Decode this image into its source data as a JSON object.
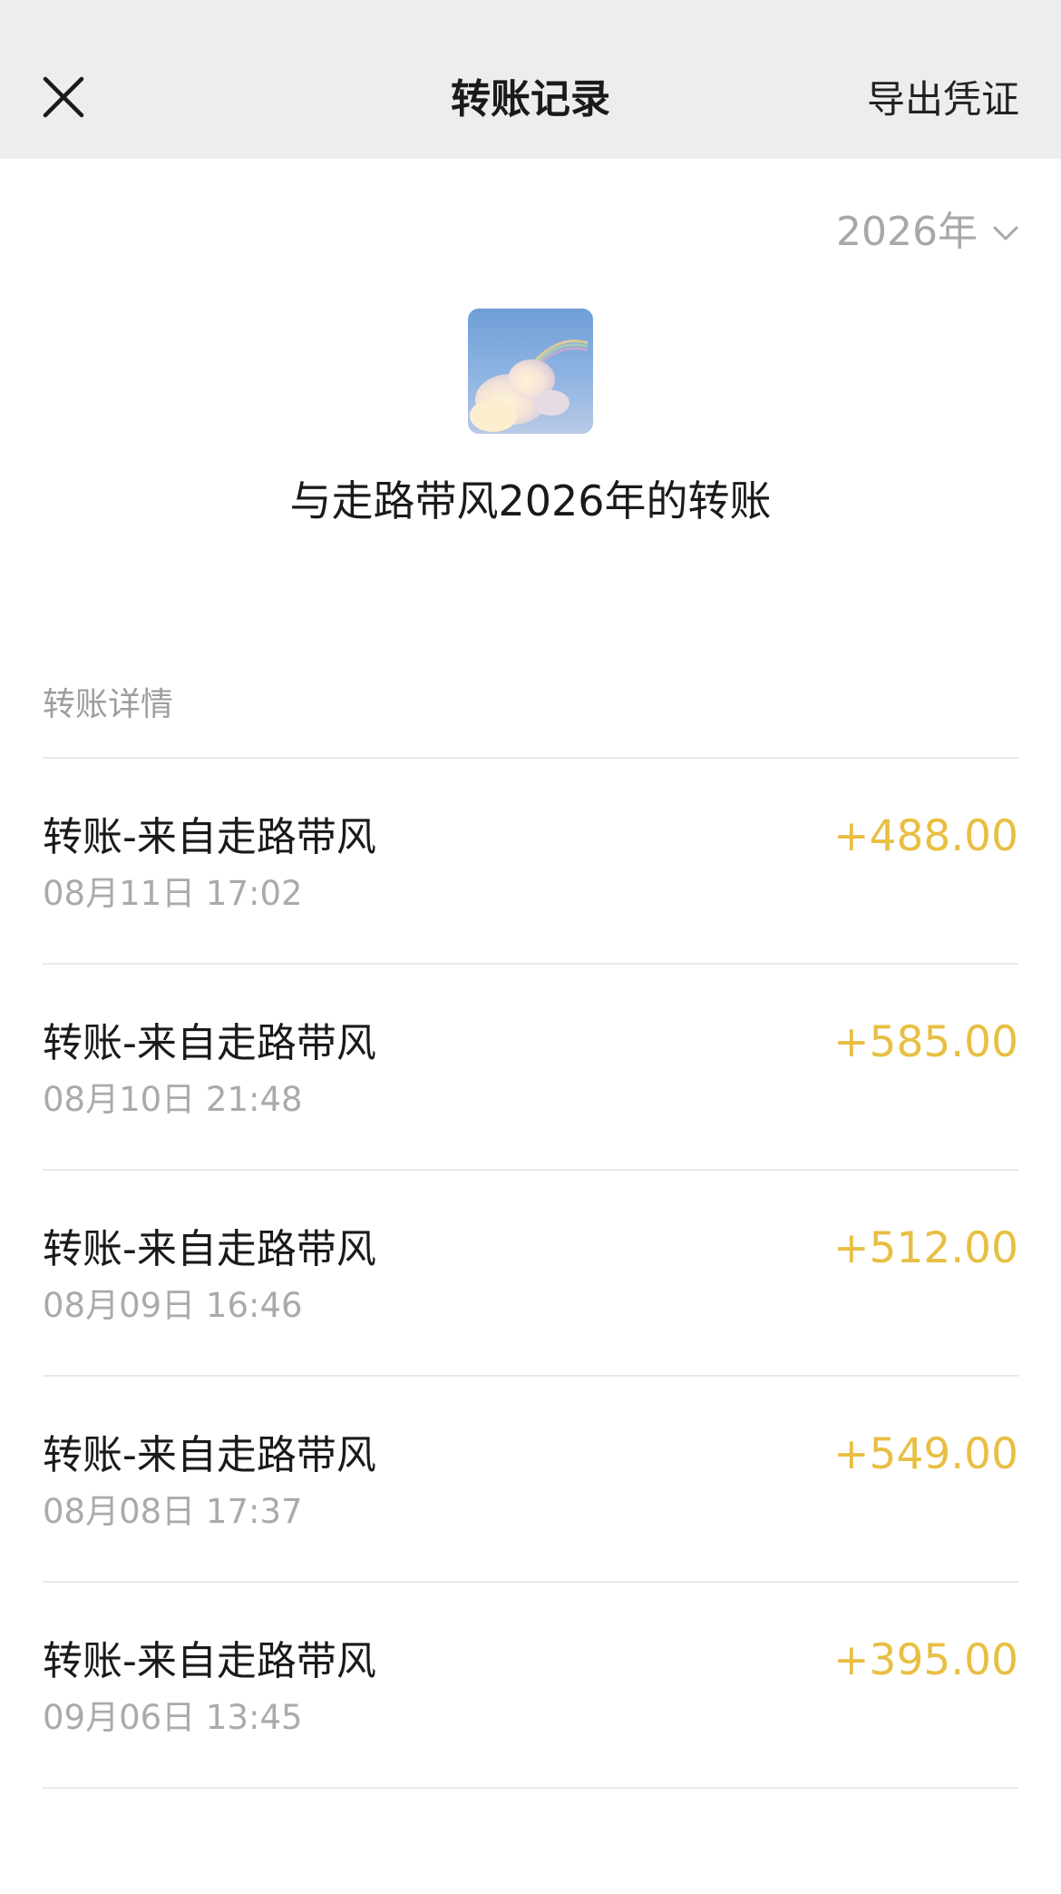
{
  "nav": {
    "title": "转账记录",
    "action_label": "导出凭证"
  },
  "year_picker": {
    "label": "2026年"
  },
  "header": {
    "title": "与走路带风2026年的转账"
  },
  "section": {
    "label": "转账详情"
  },
  "records": [
    {
      "title": "转账-来自走路带风",
      "time": "08月11日 17:02",
      "amount": "+488.00"
    },
    {
      "title": "转账-来自走路带风",
      "time": "08月10日 21:48",
      "amount": "+585.00"
    },
    {
      "title": "转账-来自走路带风",
      "time": "08月09日 16:46",
      "amount": "+512.00"
    },
    {
      "title": "转账-来自走路带风",
      "time": "08月08日 17:37",
      "amount": "+549.00"
    },
    {
      "title": "转账-来自走路带风",
      "time": "09月06日 13:45",
      "amount": "+395.00"
    }
  ],
  "colors": {
    "nav_background": "#ededed",
    "amount": "#e8bf42",
    "secondary_text": "#aaaaaa"
  },
  "icons": {
    "close": "close-icon",
    "chevron": "chevron-down-icon"
  }
}
